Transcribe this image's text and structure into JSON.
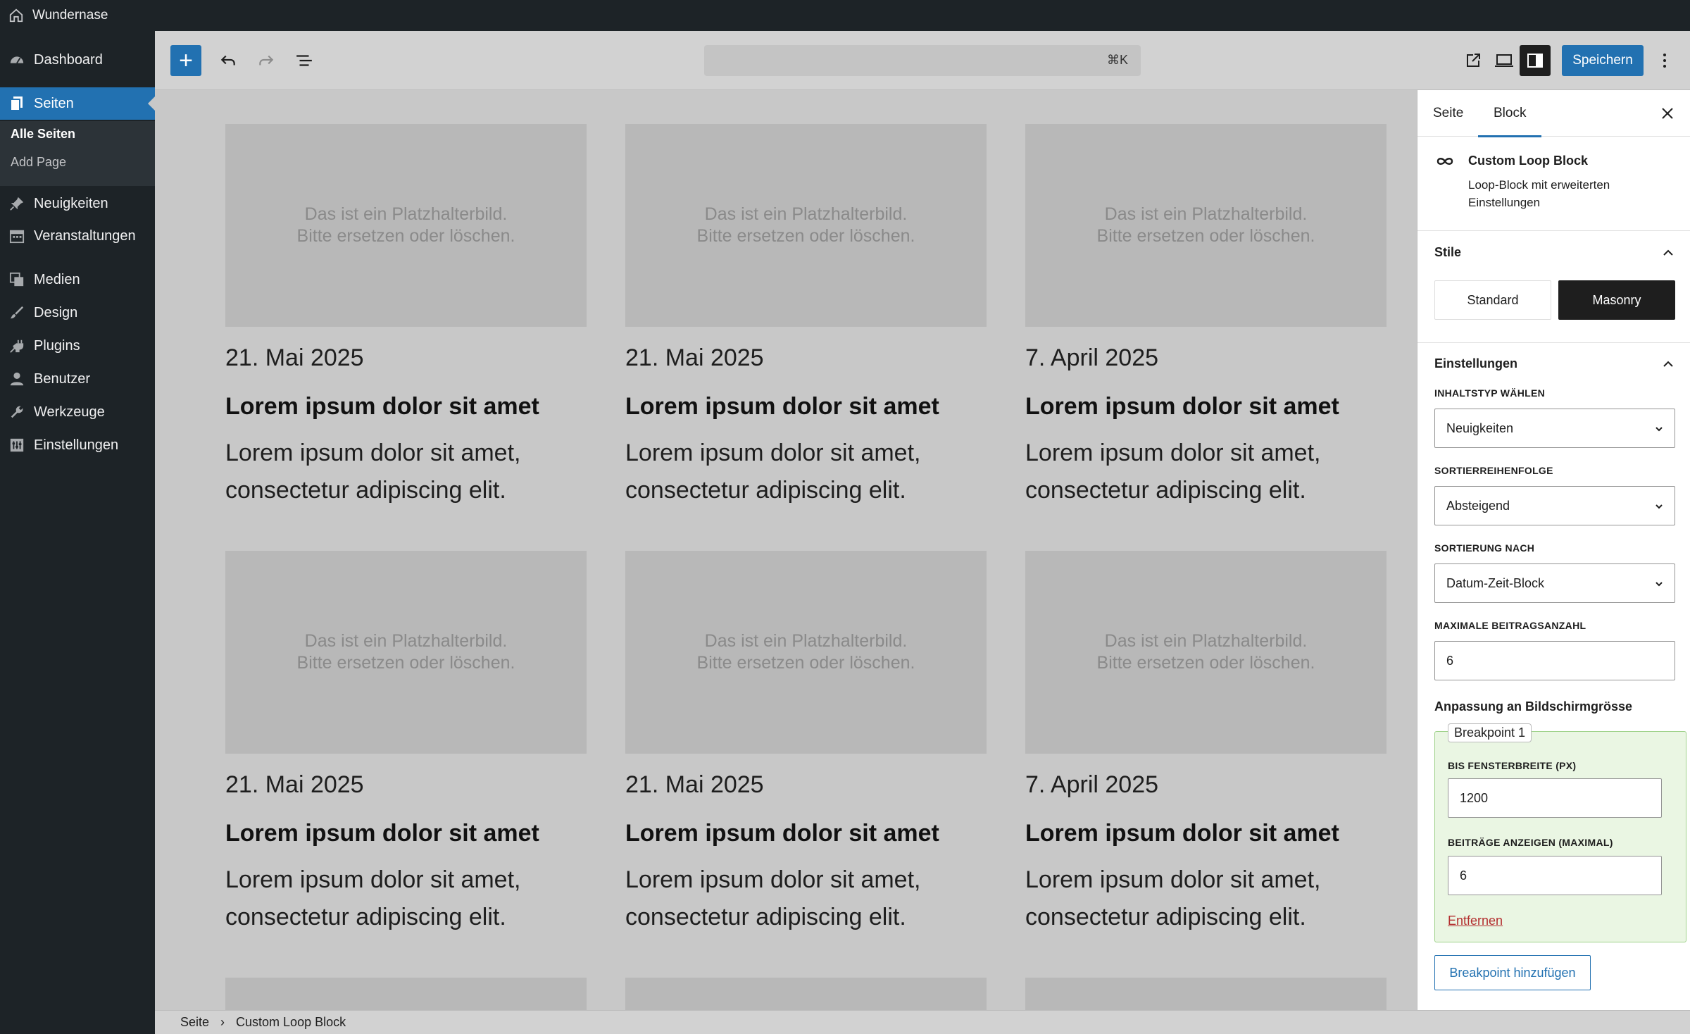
{
  "adminbar": {
    "site_name": "Wundernase"
  },
  "sidebar": {
    "items": [
      {
        "label": "Dashboard",
        "icon": "dashboard-icon"
      },
      {
        "label": "Seiten",
        "icon": "pages-icon"
      },
      {
        "label": "Neuigkeiten",
        "icon": "pin-icon"
      },
      {
        "label": "Veranstaltungen",
        "icon": "calendar-icon"
      },
      {
        "label": "Medien",
        "icon": "media-icon"
      },
      {
        "label": "Design",
        "icon": "brush-icon"
      },
      {
        "label": "Plugins",
        "icon": "plugin-icon"
      },
      {
        "label": "Benutzer",
        "icon": "user-icon"
      },
      {
        "label": "Werkzeuge",
        "icon": "wrench-icon"
      },
      {
        "label": "Einstellungen",
        "icon": "settings-icon"
      }
    ],
    "submenu": {
      "all_pages": "Alle Seiten",
      "add_page": "Add Page"
    }
  },
  "toolbar": {
    "command_shortcut": "⌘K",
    "save_label": "Speichern"
  },
  "canvas": {
    "placeholder_line1": "Das ist ein Platzhalterbild.",
    "placeholder_line2": "Bitte ersetzen oder löschen.",
    "posts": [
      {
        "date": "21. Mai 2025",
        "title": "Lorem ipsum dolor sit amet",
        "excerpt_line1": "Lorem ipsum dolor sit amet,",
        "excerpt_line2": "consectetur adipiscing elit."
      },
      {
        "date": "21. Mai 2025",
        "title": "Lorem ipsum dolor sit amet",
        "excerpt_line1": "Lorem ipsum dolor sit amet,",
        "excerpt_line2": "consectetur adipiscing elit."
      },
      {
        "date": "7. April 2025",
        "title": "Lorem ipsum dolor sit amet",
        "excerpt_line1": "Lorem ipsum dolor sit amet,",
        "excerpt_line2": "consectetur adipiscing elit."
      },
      {
        "date": "21. Mai 2025",
        "title": "Lorem ipsum dolor sit amet",
        "excerpt_line1": "Lorem ipsum dolor sit amet,",
        "excerpt_line2": "consectetur adipiscing elit."
      },
      {
        "date": "21. Mai 2025",
        "title": "Lorem ipsum dolor sit amet",
        "excerpt_line1": "Lorem ipsum dolor sit amet,",
        "excerpt_line2": "consectetur adipiscing elit."
      },
      {
        "date": "7. April 2025",
        "title": "Lorem ipsum dolor sit amet",
        "excerpt_line1": "Lorem ipsum dolor sit amet,",
        "excerpt_line2": "consectetur adipiscing elit."
      }
    ]
  },
  "breadcrumb": {
    "root": "Seite",
    "separator": "›",
    "current": "Custom Loop Block"
  },
  "panel": {
    "tabs": [
      "Seite",
      "Block"
    ],
    "block": {
      "name": "Custom Loop Block",
      "description": "Loop-Block mit erweiterten Einstellungen"
    },
    "styles": {
      "heading": "Stile",
      "options": [
        "Standard",
        "Masonry"
      ],
      "selected": "Masonry"
    },
    "settings": {
      "heading": "Einstellungen",
      "content_type_label": "Inhaltstyp wählen",
      "content_type_value": "Neuigkeiten",
      "order_label": "Sortierreihenfolge",
      "order_value": "Absteigend",
      "orderby_label": "Sortierung nach",
      "orderby_value": "Datum-Zeit-Block",
      "max_posts_label": "Maximale Beitragsanzahl",
      "max_posts_value": "6"
    },
    "responsive": {
      "heading": "Anpassung an Bildschirmgrösse",
      "breakpoint_legend": "Breakpoint 1",
      "width_label": "Bis Fensterbreite (px)",
      "width_value": "1200",
      "posts_label": "Beiträge anzeigen (maximal)",
      "posts_value": "6",
      "remove_label": "Entfernen",
      "add_label": "Breakpoint hinzufügen"
    }
  }
}
